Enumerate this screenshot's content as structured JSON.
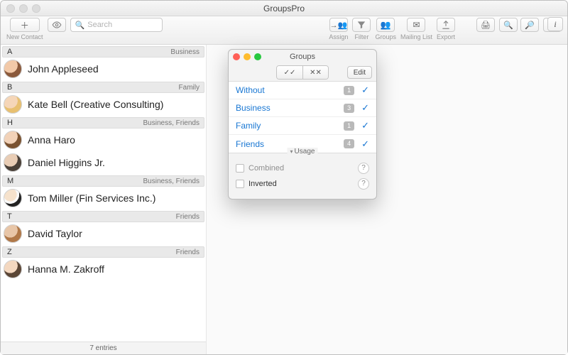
{
  "window": {
    "title": "GroupsPro"
  },
  "toolbar": {
    "new_contact": "New Contact",
    "search_placeholder": "Search",
    "assign": "Assign",
    "filter": "Filter",
    "groups": "Groups",
    "mailing_list": "Mailing List",
    "export": "Export"
  },
  "index_letters": [
    "A",
    "B",
    "H",
    "M",
    "T",
    "Z"
  ],
  "sections": [
    {
      "letter": "A",
      "tag": "Business",
      "contacts": [
        {
          "name": "John Appleseed",
          "tag": ""
        }
      ]
    },
    {
      "letter": "B",
      "tag": "Family",
      "contacts": [
        {
          "name": "Kate Bell (Creative Consulting)",
          "tag": ""
        }
      ]
    },
    {
      "letter": "H",
      "tag": "Business, Friends",
      "contacts": [
        {
          "name": "Anna Haro",
          "tag": ""
        },
        {
          "name": "Daniel Higgins Jr.",
          "tag": ""
        }
      ]
    },
    {
      "letter": "M",
      "tag": "Business, Friends",
      "contacts": [
        {
          "name": "Tom Miller (Fin Services Inc.)",
          "tag": ""
        }
      ]
    },
    {
      "letter": "T",
      "tag": "Friends",
      "contacts": [
        {
          "name": "David Taylor",
          "tag": ""
        }
      ]
    },
    {
      "letter": "Z",
      "tag": "Friends",
      "contacts": [
        {
          "name": "Hanna M. Zakroff",
          "tag": ""
        }
      ]
    }
  ],
  "footer": {
    "entries": "7 entries"
  },
  "groups_panel": {
    "title": "Groups",
    "edit": "Edit",
    "select_all_icon": "✓✓",
    "select_none_icon": "✕✕",
    "rows": [
      {
        "name": "Without",
        "count": "1",
        "checked": true
      },
      {
        "name": "Business",
        "count": "3",
        "checked": true
      },
      {
        "name": "Family",
        "count": "1",
        "checked": true
      },
      {
        "name": "Friends",
        "count": "4",
        "checked": true
      }
    ],
    "usage_label": "Usage",
    "combined": "Combined",
    "inverted": "Inverted",
    "help": "?"
  }
}
